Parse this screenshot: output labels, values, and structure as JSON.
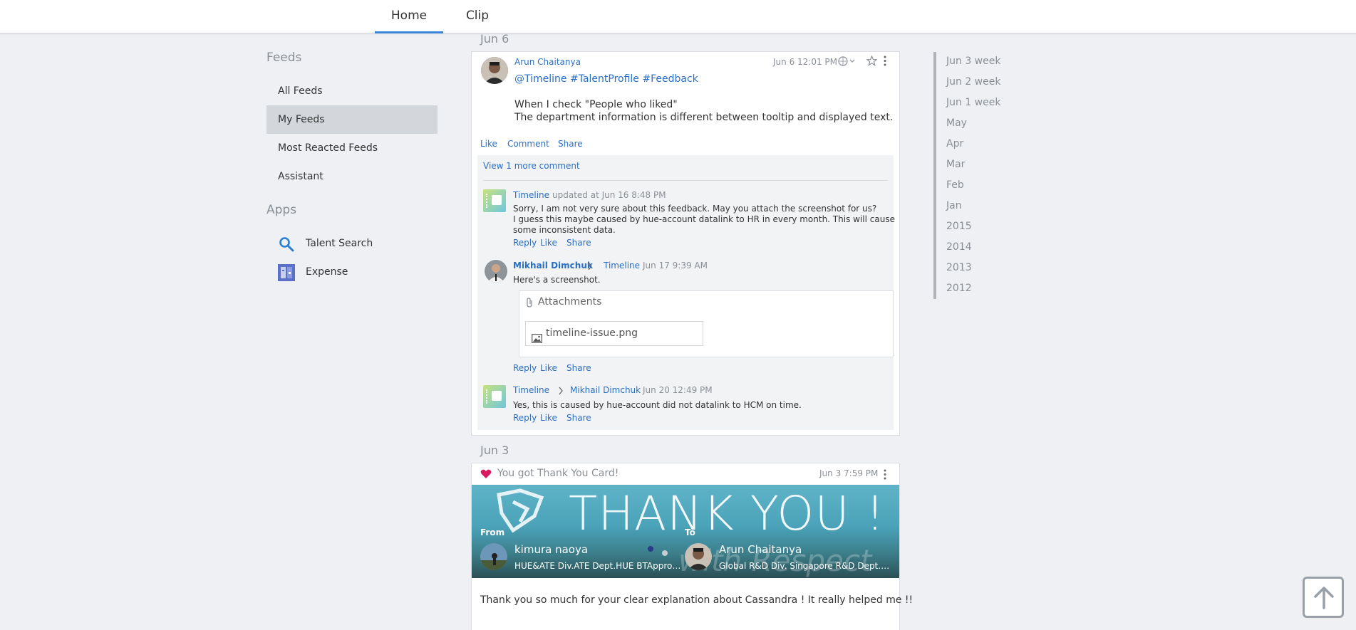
{
  "nav": {
    "tabs": [
      "Home",
      "Clip"
    ]
  },
  "sidebar": {
    "feeds_heading": "Feeds",
    "feeds": [
      "All Feeds",
      "My Feeds",
      "Most Reacted Feeds",
      "Assistant"
    ],
    "apps_heading": "Apps",
    "apps": [
      {
        "label": "Talent Search",
        "icon": "search-icon"
      },
      {
        "label": "Expense",
        "icon": "expense-icon"
      }
    ]
  },
  "feed": {
    "date1": "Jun 6",
    "post": {
      "author": "Arun Chaitanya",
      "timestamp": "Jun 6 12:01 PM",
      "tags": "@Timeline #TalentProfile #Feedback",
      "body_line1": "When I check \"People who liked\"",
      "body_line2": "The department information is different between tooltip and displayed text.",
      "actions": [
        "Like",
        "Comment",
        "Share"
      ],
      "view_more": "View 1 more comment",
      "comments": [
        {
          "author": "Timeline",
          "meta": "updated at Jun 16 8:48 PM",
          "text_line1": "Sorry, I am not very sure about this feedback. May you attach the screenshot for us?",
          "text_line2": "I guess this maybe caused by hue-account datalink to HR in every month. This will cause",
          "text_line3": "some inconsistent data.",
          "actions": [
            "Reply",
            "Like",
            "Share"
          ]
        },
        {
          "author": "Mikhail Dimchuk",
          "to": "Timeline",
          "time": "Jun 17 9:39 AM",
          "text": "Here's a screenshot.",
          "attachments_label": "Attachments",
          "file": "timeline-issue.png",
          "actions": [
            "Reply",
            "Like",
            "Share"
          ]
        },
        {
          "author": "Timeline",
          "to": "Mikhail Dimchuk",
          "time": "Jun 20 12:49 PM",
          "text": "Yes, this is caused by hue-account did not datalink to HCM on time.",
          "actions": [
            "Reply",
            "Like",
            "Share"
          ]
        }
      ]
    },
    "date2": "Jun 3",
    "thanks": {
      "title": "You got Thank You Card!",
      "timestamp": "Jun 3 7:59 PM",
      "banner_text": "THANK YOU !",
      "banner_sub": "with Respect",
      "from_label": "From",
      "from_name": "kimura naoya",
      "from_dept": "HUE&ATE Div.ATE Dept.HUE BTApprova...",
      "to_label": "To",
      "to_name": "Arun Chaitanya",
      "to_dept": "Global R&D Div. Singapore R&D Dept.Si...",
      "message": "Thank you so much for your clear explanation about Cassandra ! It really helped me !!"
    }
  },
  "timeline_nav": [
    "Jun 3 week",
    "Jun 2 week",
    "Jun 1 week",
    "May",
    "Apr",
    "Mar",
    "Feb",
    "Jan",
    "2015",
    "2014",
    "2013",
    "2012"
  ],
  "colors": {
    "accent": "#3a86d9",
    "link": "#2a6fc4",
    "heart": "#d81b60"
  }
}
